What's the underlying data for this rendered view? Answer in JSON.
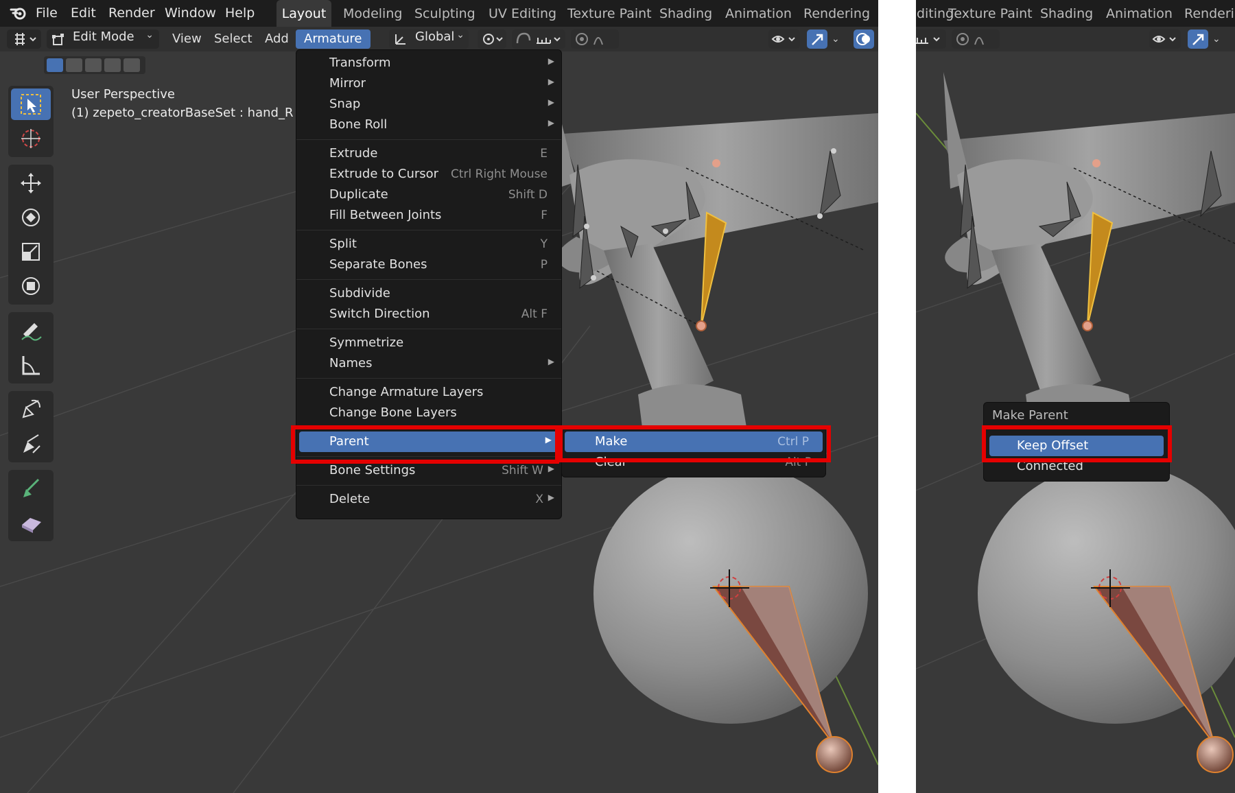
{
  "topbar": {
    "menus": [
      "File",
      "Edit",
      "Render",
      "Window",
      "Help"
    ],
    "workspace_tabs": [
      "Layout",
      "Modeling",
      "Sculpting",
      "UV Editing",
      "Texture Paint",
      "Shading",
      "Animation",
      "Rendering"
    ],
    "active_tab": "Layout"
  },
  "header": {
    "mode": "Edit Mode",
    "view": "View",
    "select": "Select",
    "add": "Add",
    "armature": "Armature",
    "orientation": "Global"
  },
  "viewport": {
    "perspective": "User Perspective",
    "object": "(1) zepeto_creatorBaseSet : hand_R"
  },
  "armature_menu": {
    "items": [
      {
        "label": "Transform",
        "shortcut": "",
        "submenu": true
      },
      {
        "label": "Mirror",
        "shortcut": "",
        "submenu": true
      },
      {
        "label": "Snap",
        "shortcut": "",
        "submenu": true
      },
      {
        "label": "Bone Roll",
        "shortcut": "",
        "submenu": true
      },
      {
        "label": "Extrude",
        "shortcut": "E",
        "submenu": false
      },
      {
        "label": "Extrude to Cursor",
        "shortcut": "Ctrl Right Mouse",
        "submenu": false
      },
      {
        "label": "Duplicate",
        "shortcut": "Shift D",
        "submenu": false
      },
      {
        "label": "Fill Between Joints",
        "shortcut": "F",
        "submenu": false
      },
      {
        "label": "Split",
        "shortcut": "Y",
        "submenu": false
      },
      {
        "label": "Separate Bones",
        "shortcut": "P",
        "submenu": false
      },
      {
        "label": "Subdivide",
        "shortcut": "",
        "submenu": false
      },
      {
        "label": "Switch Direction",
        "shortcut": "Alt F",
        "submenu": false
      },
      {
        "label": "Symmetrize",
        "shortcut": "",
        "submenu": false
      },
      {
        "label": "Names",
        "shortcut": "",
        "submenu": true
      },
      {
        "label": "Change Armature Layers",
        "shortcut": "",
        "submenu": false
      },
      {
        "label": "Change Bone Layers",
        "shortcut": "",
        "submenu": false
      },
      {
        "label": "Parent",
        "shortcut": "",
        "submenu": true
      },
      {
        "label": "Bone Settings",
        "shortcut": "Shift W",
        "submenu": true
      },
      {
        "label": "Delete",
        "shortcut": "X",
        "submenu": true
      }
    ]
  },
  "parent_submenu": {
    "items": [
      {
        "label": "Make",
        "shortcut": "Ctrl P"
      },
      {
        "label": "Clear",
        "shortcut": "Alt P"
      }
    ]
  },
  "make_parent_popup": {
    "title": "Make Parent",
    "options": [
      "Keep Offset",
      "Connected"
    ]
  },
  "colors": {
    "highlight": "#4772b3",
    "callout_red": "#e50000",
    "bone_selected": "#e0a000"
  }
}
